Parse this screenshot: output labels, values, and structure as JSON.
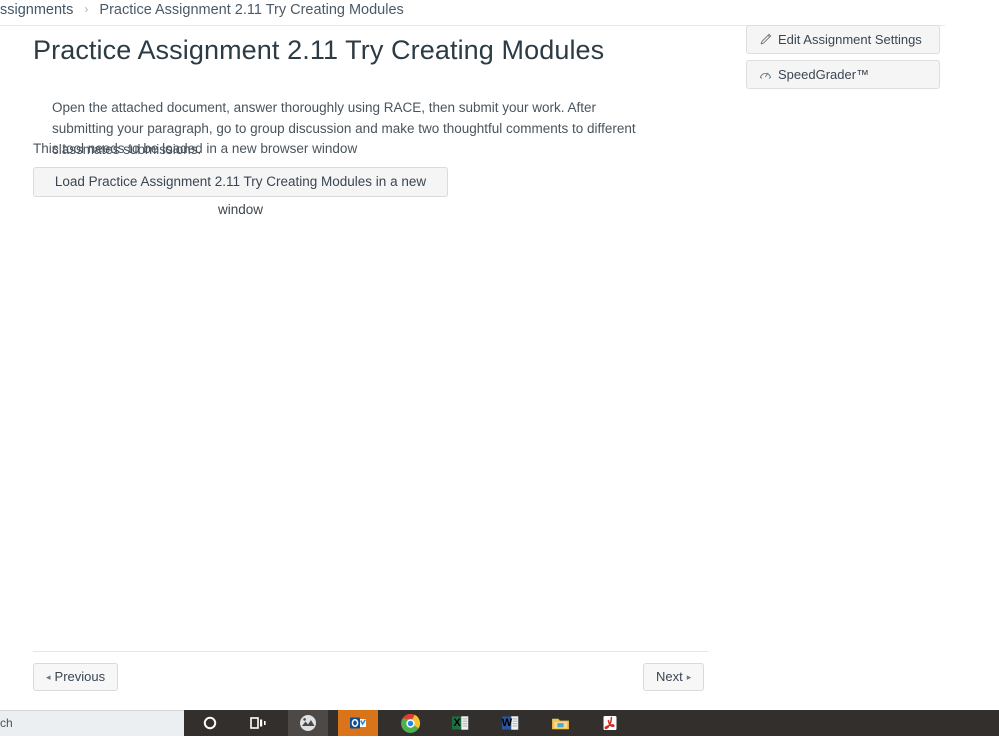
{
  "breadcrumb": {
    "parent": "ssignments",
    "separator": "›",
    "current": "Practice Assignment 2.11 Try Creating Modules"
  },
  "page": {
    "title": "Practice Assignment 2.11 Try Creating Modules",
    "description": "Open the attached document, answer thoroughly using RACE, then submit your work.  After submitting your paragraph, go to group discussion and make two thoughtful comments to different classmates submissions.",
    "tool_notice": "This tool needs to be loaded in a new browser window",
    "load_tool_label": "Load Practice Assignment 2.11 Try Creating Modules in a new window"
  },
  "sidebar": {
    "buttons": [
      {
        "label": "Edit Assignment Settings",
        "icon": "pencil-icon"
      },
      {
        "label": "SpeedGrader™",
        "icon": "speedgrader-gauge-icon"
      }
    ]
  },
  "footer_nav": {
    "previous_label": "Previous",
    "previous_arrow": "◂",
    "next_label": "Next",
    "next_arrow": "▸"
  },
  "taskbar": {
    "search_text": "ch",
    "items": [
      {
        "name": "cortana-search-icon",
        "label": ""
      },
      {
        "name": "task-view-icon",
        "label": ""
      },
      {
        "name": "photos-app-icon",
        "label": ""
      },
      {
        "name": "outlook-icon",
        "label": "O"
      },
      {
        "name": "chrome-icon",
        "label": ""
      },
      {
        "name": "excel-icon",
        "label": "X"
      },
      {
        "name": "word-icon",
        "label": "W"
      },
      {
        "name": "file-explorer-icon",
        "label": ""
      },
      {
        "name": "adobe-acrobat-icon",
        "label": ""
      }
    ]
  },
  "colors": {
    "canvas_text": "#2d3b45",
    "taskbar_bg": "#332f2d",
    "outlook_orange": "#d9741a",
    "excel_green": "#1d7044",
    "word_blue": "#2b579a",
    "acrobat_red": "#d42b1f",
    "folder_yellow": "#f0b429"
  }
}
